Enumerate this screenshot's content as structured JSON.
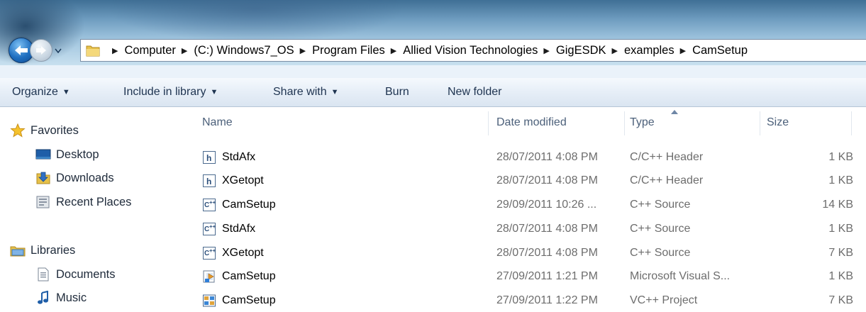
{
  "address_bar": {
    "crumbs": [
      "Computer",
      "(C:) Windows7_OS",
      "Program Files",
      "Allied Vision Technologies",
      "GigESDK",
      "examples",
      "CamSetup"
    ]
  },
  "command_bar": {
    "organize": "Organize",
    "include_in_library": "Include in library",
    "share_with": "Share with",
    "burn": "Burn",
    "new_folder": "New folder"
  },
  "nav": {
    "favorites": "Favorites",
    "desktop": "Desktop",
    "downloads": "Downloads",
    "recent_places": "Recent Places",
    "libraries": "Libraries",
    "documents": "Documents",
    "music": "Music"
  },
  "columns": {
    "name": "Name",
    "date_modified": "Date modified",
    "type": "Type",
    "size": "Size"
  },
  "files": [
    {
      "name": "StdAfx",
      "date": "28/07/2011 4:08 PM",
      "type": "C/C++ Header",
      "size": "1 KB",
      "icon": "header-file-icon"
    },
    {
      "name": "XGetopt",
      "date": "28/07/2011 4:08 PM",
      "type": "C/C++ Header",
      "size": "1 KB",
      "icon": "header-file-icon"
    },
    {
      "name": "CamSetup",
      "date": "29/09/2011 10:26 ...",
      "type": "C++ Source",
      "size": "14 KB",
      "icon": "cpp-file-icon"
    },
    {
      "name": "StdAfx",
      "date": "28/07/2011 4:08 PM",
      "type": "C++ Source",
      "size": "1 KB",
      "icon": "cpp-file-icon"
    },
    {
      "name": "XGetopt",
      "date": "28/07/2011 4:08 PM",
      "type": "C++ Source",
      "size": "7 KB",
      "icon": "cpp-file-icon"
    },
    {
      "name": "CamSetup",
      "date": "27/09/2011 1:21 PM",
      "type": "Microsoft Visual S...",
      "size": "1 KB",
      "icon": "visual-studio-solution-icon"
    },
    {
      "name": "CamSetup",
      "date": "27/09/2011 1:22 PM",
      "type": "VC++ Project",
      "size": "7 KB",
      "icon": "vcproject-file-icon"
    }
  ],
  "sort": {
    "column": "type",
    "direction": "ascending"
  }
}
